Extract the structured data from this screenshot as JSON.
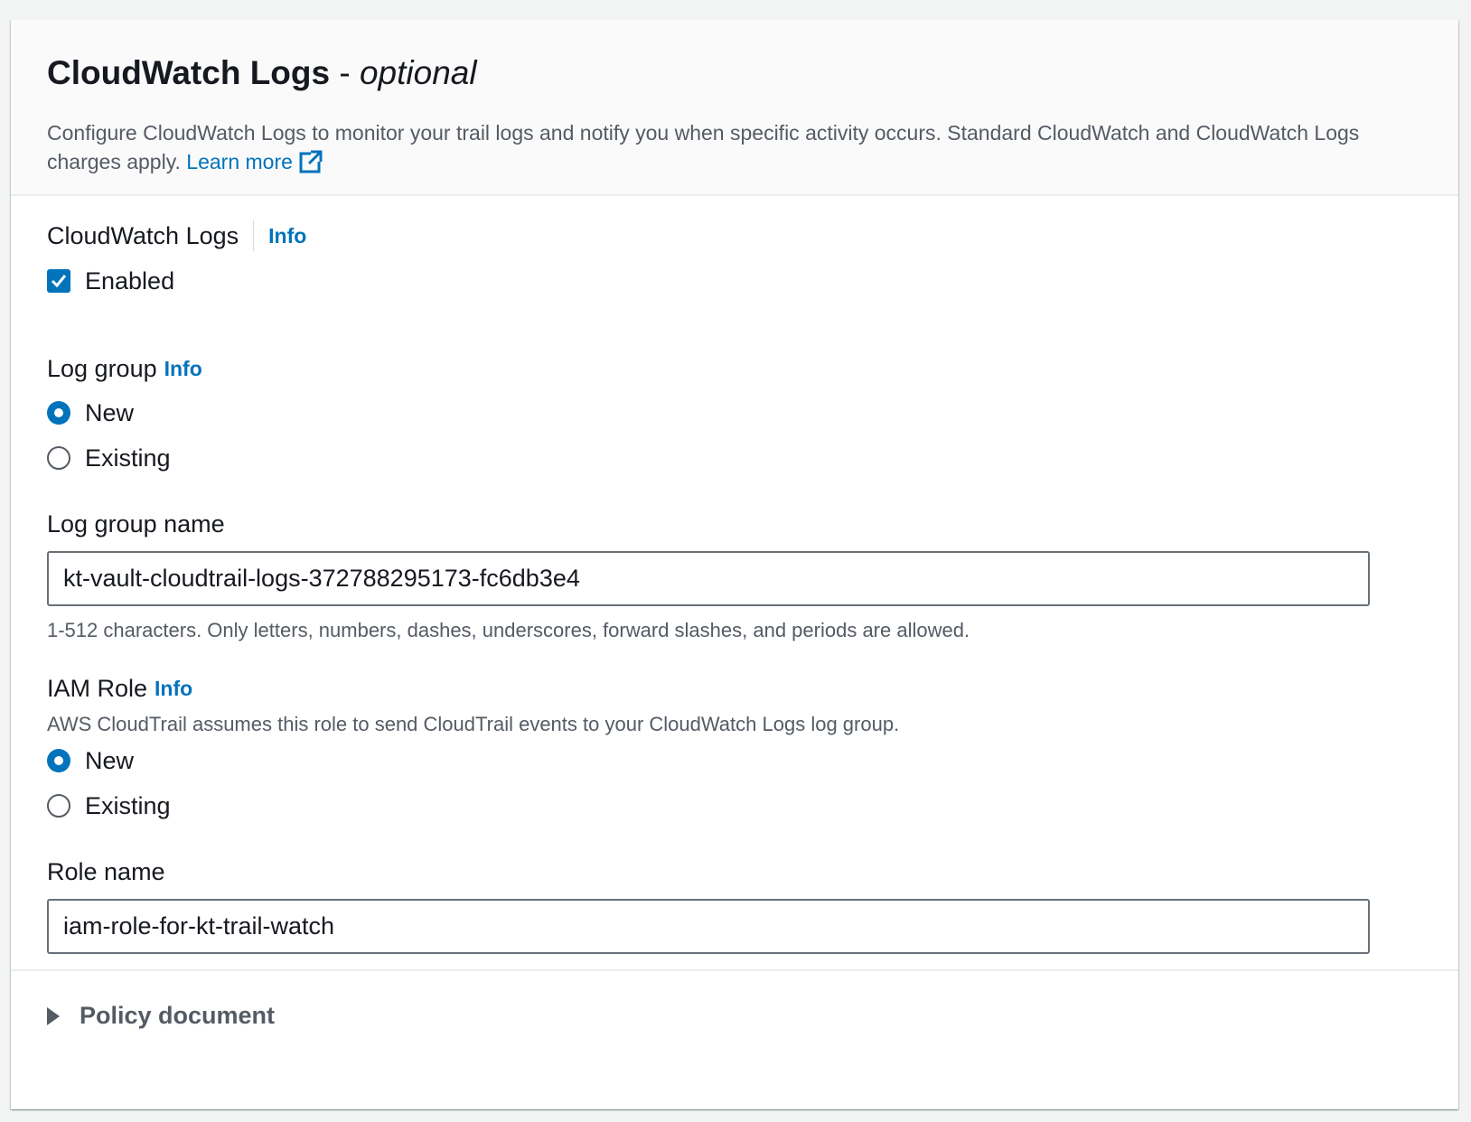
{
  "header": {
    "title": "CloudWatch Logs",
    "separator": " - ",
    "optional": "optional",
    "description": "Configure CloudWatch Logs to monitor your trail logs and notify you when specific activity occurs. Standard CloudWatch and CloudWatch Logs charges apply.",
    "learn_more": "Learn more",
    "learn_more_icon": "external-link-icon"
  },
  "cloudwatch_logs": {
    "label": "CloudWatch Logs",
    "info": "Info",
    "enabled_label": "Enabled",
    "enabled": true
  },
  "log_group": {
    "label": "Log group",
    "info": "Info",
    "options": [
      {
        "label": "New",
        "selected": true
      },
      {
        "label": "Existing",
        "selected": false
      }
    ]
  },
  "log_group_name": {
    "label": "Log group name",
    "value": "kt-vault-cloudtrail-logs-372788295173-fc6db3e4",
    "hint": "1-512 characters. Only letters, numbers, dashes, underscores, forward slashes, and periods are allowed."
  },
  "iam_role": {
    "label": "IAM Role",
    "info": "Info",
    "description": "AWS CloudTrail assumes this role to send CloudTrail events to your CloudWatch Logs log group.",
    "options": [
      {
        "label": "New",
        "selected": true
      },
      {
        "label": "Existing",
        "selected": false
      }
    ]
  },
  "role_name": {
    "label": "Role name",
    "value": "iam-role-for-kt-trail-watch"
  },
  "policy": {
    "label": "Policy document",
    "expanded": false
  },
  "colors": {
    "accent": "#0073bb",
    "text": "#16191f",
    "secondary_text": "#545b64"
  }
}
